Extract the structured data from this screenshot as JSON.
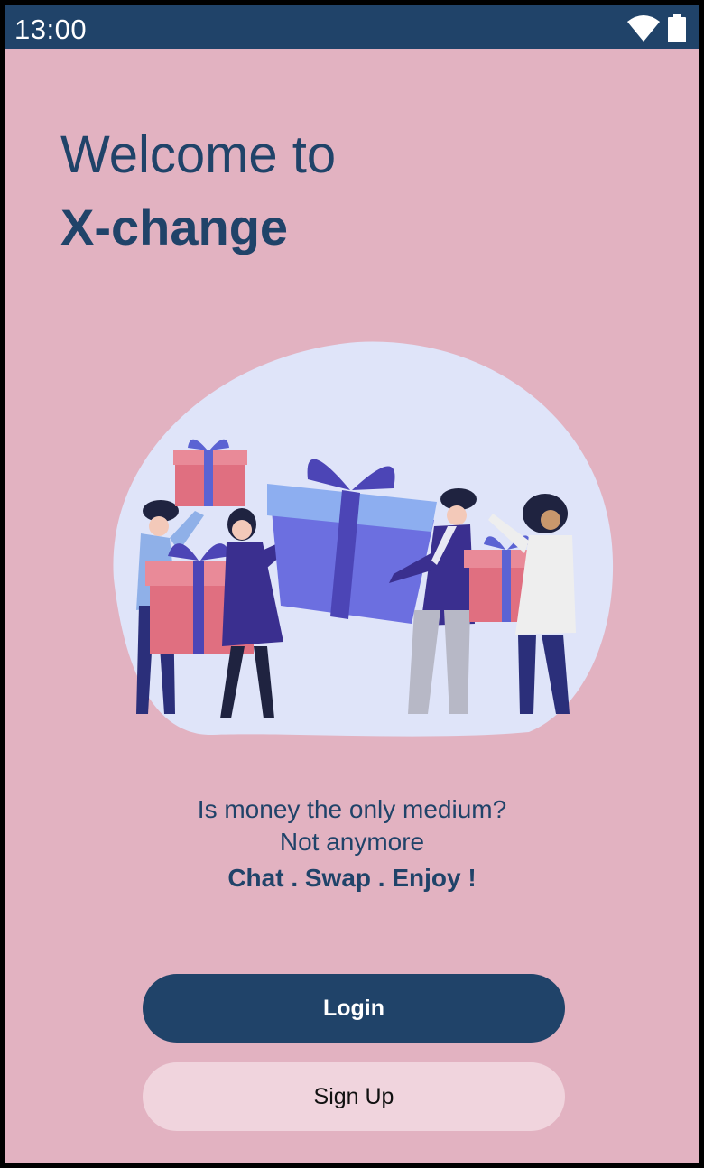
{
  "status_bar": {
    "time": "13:00",
    "icons": [
      "wifi-icon",
      "battery-icon"
    ]
  },
  "header": {
    "welcome": "Welcome to",
    "brand": "X-change"
  },
  "illustration": {
    "name": "people-exchanging-gifts-illustration"
  },
  "tagline": {
    "line1": "Is money the only medium?",
    "line2": "Not anymore",
    "line3": "Chat . Swap . Enjoy !"
  },
  "actions": {
    "login_label": "Login",
    "signup_label": "Sign Up"
  },
  "colors": {
    "background": "#e2b2c1",
    "primary": "#204369",
    "secondary_button": "#f0d4dd"
  }
}
